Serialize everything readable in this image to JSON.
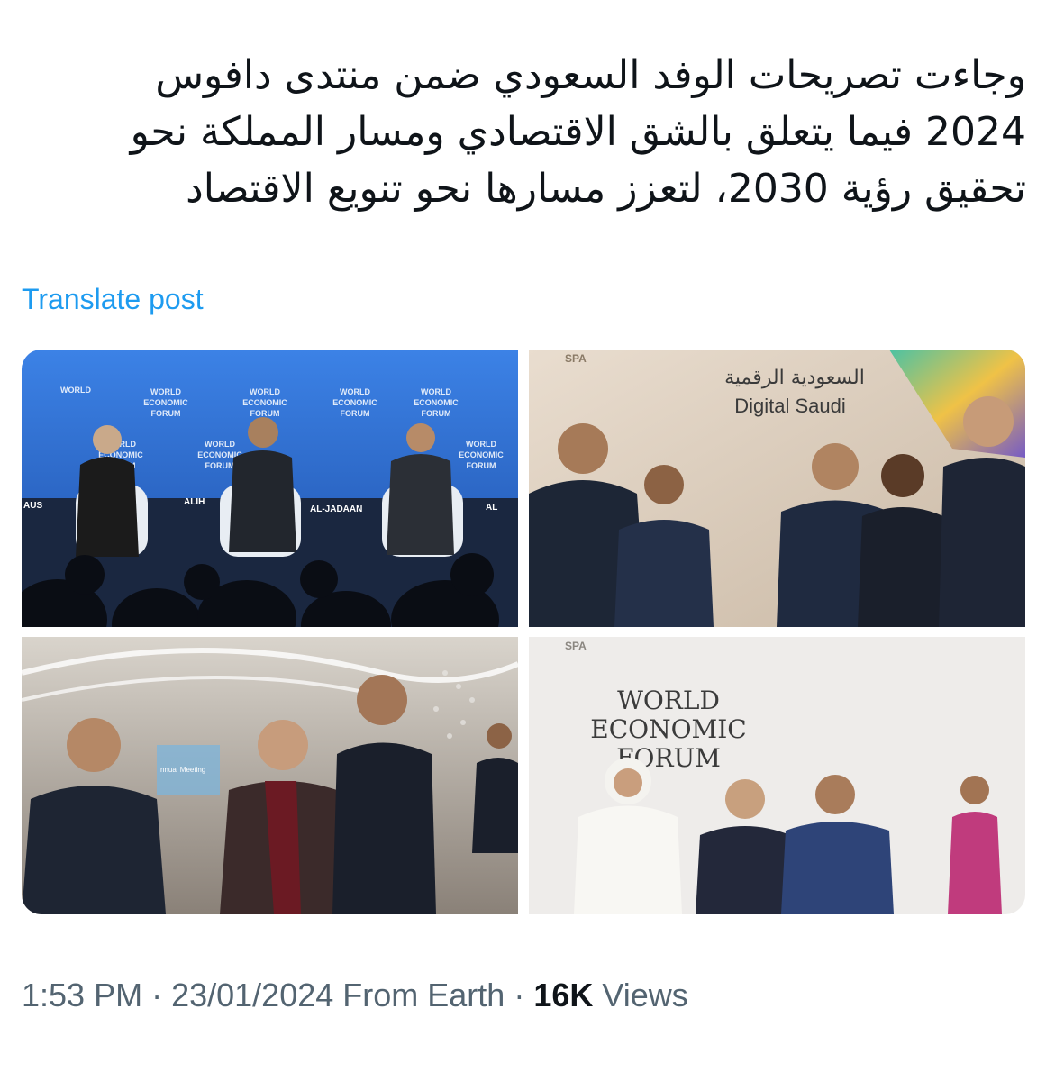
{
  "post": {
    "lines": [
      "وجاءت تصريحات الوفد السعودي ضمن منتدى دافوس",
      "2024 فيما يتعلق بالشق الاقتصادي ومسار المملكة نحو",
      "تحقيق رؤية 2030، لتعزز مسارها نحو تنويع الاقتصاد"
    ],
    "translate_label": "Translate post"
  },
  "media": {
    "photo1": {
      "wef_text": "WORLD ECONOMIC FORUM",
      "wef_line1": "WORLD",
      "wef_line2": "ECONOMIC",
      "wef_line3": "FORUM",
      "name_left": "AUS",
      "name_mid": "ALIH",
      "name_right": "AL-JADAAN",
      "name_far": "AL"
    },
    "photo2": {
      "sign_ar": "السعودية الرقمية",
      "sign_en": "Digital Saudi",
      "watermark": "SPA"
    },
    "photo3": {
      "screen_text": "nnual Meeting"
    },
    "photo4": {
      "wall_line1": "WORLD",
      "wall_line2": "ECONOMIC",
      "wall_line3": "FORUM",
      "watermark": "SPA"
    },
    "colors": {
      "stage_blue": "#2f6fd6",
      "link_blue": "#1d9bf0"
    }
  },
  "meta": {
    "time": "1:53 PM",
    "separator": " · ",
    "date": "23/01/2024",
    "source": "From Earth",
    "views_count": "16K",
    "views_label": "Views"
  }
}
